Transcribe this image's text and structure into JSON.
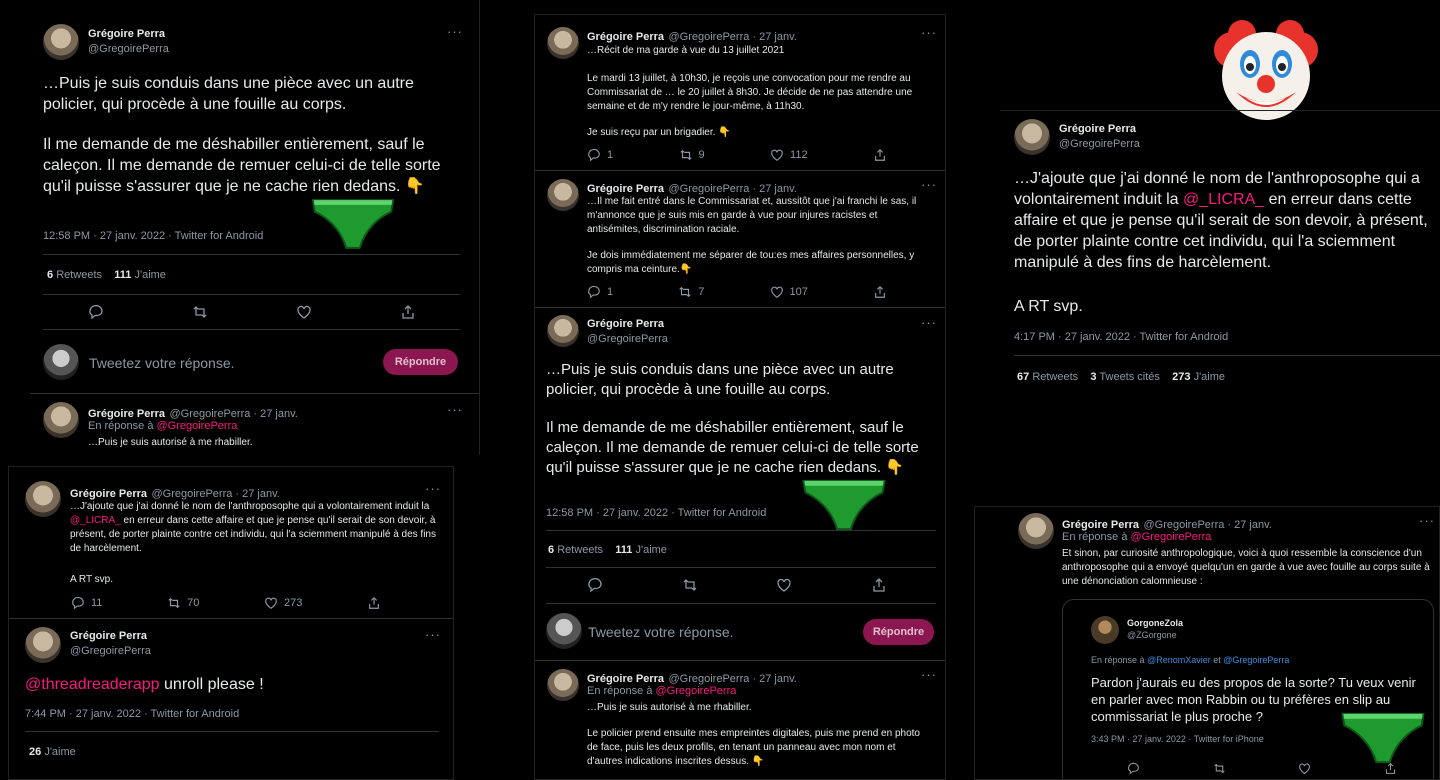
{
  "colors": {
    "link": "#f91880",
    "reply_button": "#8c1650",
    "divider": "#2f3336"
  },
  "p1": {
    "author": "Grégoire Perra",
    "handle": "@GregoirePerra",
    "text1": "…Puis je suis conduis dans une pièce avec un autre policier, qui procède à une fouille au corps.",
    "text2": "Il me demande de me déshabiller entièrement, sauf le caleçon. Il me demande de remuer celui-ci de telle sorte qu'il puisse s'assurer que je ne cache rien dedans. 👇",
    "meta": "12:58 PM · 27 janv. 2022 · Twitter for Android",
    "rt_count": "6",
    "rt_label": "Retweets",
    "like_count": "111",
    "like_label": "J'aime",
    "reply_placeholder": "Tweetez votre réponse.",
    "reply_button": "Répondre",
    "t2_author": "Grégoire Perra",
    "t2_handle_date": "@GregoirePerra · 27 janv.",
    "t2_reply_prefix": "En réponse à",
    "t2_reply_to": "@GregoirePerra",
    "t2_text": "…Puis je suis autorisé à me rhabiller."
  },
  "p2": {
    "t1_author": "Grégoire Perra",
    "t1_handle_date": "@GregoirePerra · 27 janv.",
    "t1_text": "…J'ajoute que j'ai donné le nom de l'anthroposophe qui a volontairement induit la",
    "t1_link": "@_LICRA_",
    "t1_text_b": "en erreur dans cette affaire et que je pense qu'il serait de son devoir, à présent, de porter plainte contre cet individu, qui l'a sciemment manipulé à des fins de harcèlement.",
    "t1_text2": "A RT svp.",
    "t1_replies": "11",
    "t1_rts": "70",
    "t1_likes": "273",
    "t2_author": "Grégoire Perra",
    "t2_handle": "@GregoirePerra",
    "t2_link": "@threadreaderapp",
    "t2_text": "unroll please !",
    "t2_meta": "7:44 PM · 27 janv. 2022 · Twitter for Android",
    "t2_like_count": "26",
    "t2_like_label": "J'aime"
  },
  "p3": {
    "t1_author": "Grégoire Perra",
    "t1_handle_date": "@GregoirePerra · 27 janv.",
    "t1_text1": "…Récit de ma garde à vue du 13 juillet 2021",
    "t1_text2": "Le mardi 13 juillet, à 10h30, je reçois une convocation pour me rendre au Commissariat de … le 20 juillet à 8h30. Je décide de ne pas attendre une semaine et de m'y rendre le jour-même, à 11h30.",
    "t1_text3": "Je suis reçu par un brigadier. 👇",
    "t1_replies": "1",
    "t1_rts": "9",
    "t1_likes": "112",
    "t2_author": "Grégoire Perra",
    "t2_handle_date": "@GregoirePerra · 27 janv.",
    "t2_text1": "…Il me fait entré dans le Commissariat et, aussitôt que j'ai franchi le sas, il m'annonce que je suis mis en garde à vue pour injures racistes et antisémites, discrimination raciale.",
    "t2_text2": "Je dois immédiatement me séparer de tou:es mes affaires personnelles, y compris ma ceinture.👇",
    "t2_replies": "1",
    "t2_rts": "7",
    "t2_likes": "107",
    "t3_author": "Grégoire Perra",
    "t3_handle": "@GregoirePerra",
    "t3_text1": "…Puis je suis conduis dans une pièce avec un autre policier, qui procède à une fouille au corps.",
    "t3_text2": "Il me demande de me déshabiller entièrement, sauf le caleçon. Il me demande de remuer celui-ci de telle sorte qu'il puisse s'assurer que je ne cache rien dedans. 👇",
    "t3_meta": "12:58 PM · 27 janv. 2022 · Twitter for Android",
    "t3_rt_count": "6",
    "t3_rt_label": "Retweets",
    "t3_like_count": "111",
    "t3_like_label": "J'aime",
    "reply_placeholder": "Tweetez votre réponse.",
    "reply_button": "Répondre",
    "t4_author": "Grégoire Perra",
    "t4_handle_date": "@GregoirePerra · 27 janv.",
    "t4_reply_prefix": "En réponse à",
    "t4_reply_to": "@GregoirePerra",
    "t4_text1": "…Puis je suis autorisé à me rhabiller.",
    "t4_text2": "Le policier prend ensuite mes empreintes digitales, puis me prend en photo de face, puis les deux profils, en tenant un panneau avec mon nom et d'autres indications inscrites dessus. 👇"
  },
  "p4": {
    "author": "Grégoire Perra",
    "handle": "@GregoirePerra",
    "text1": "…J'ajoute que j'ai donné le nom de l'anthroposophe qui a volontairement induit la",
    "link": "@_LICRA_",
    "text1b": "en erreur dans cette affaire et que je pense qu'il serait de son devoir, à présent, de porter plainte contre cet individu, qui l'a sciemment manipulé à des fins de harcèlement.",
    "text2": "A RT svp.",
    "meta": "4:17 PM · 27 janv. 2022 · Twitter for Android",
    "rt_count": "67",
    "rt_label": "Retweets",
    "quote_count": "3",
    "quote_label": "Tweets cités",
    "like_count": "273",
    "like_label": "J'aime"
  },
  "p5": {
    "author": "Grégoire Perra",
    "handle_date": "@GregoirePerra · 27 janv.",
    "reply_prefix": "En réponse à",
    "reply_to": "@GregoirePerra",
    "text": "Et sinon, par curiosité anthropologique, voici à quoi ressemble la conscience d'un anthroposophe qui a envoyé quelqu'un en garde à vue avec fouille au corps suite à une dénonciation calomnieuse :",
    "q_author": "GorgoneZola",
    "q_handle": "@ZGorgone",
    "q_reply_prefix": "En réponse à",
    "q_reply_to1": "@RenomXavier",
    "q_and": "et",
    "q_reply_to2": "@GregoirePerra",
    "q_text": "Pardon j'aurais eu des propos de la sorte? Tu veux venir en parler avec mon Rabbin ou tu préfères en slip au commissariat le plus proche ?",
    "q_meta": "3:43 PM · 27 janv. 2022 · Twitter for iPhone"
  }
}
